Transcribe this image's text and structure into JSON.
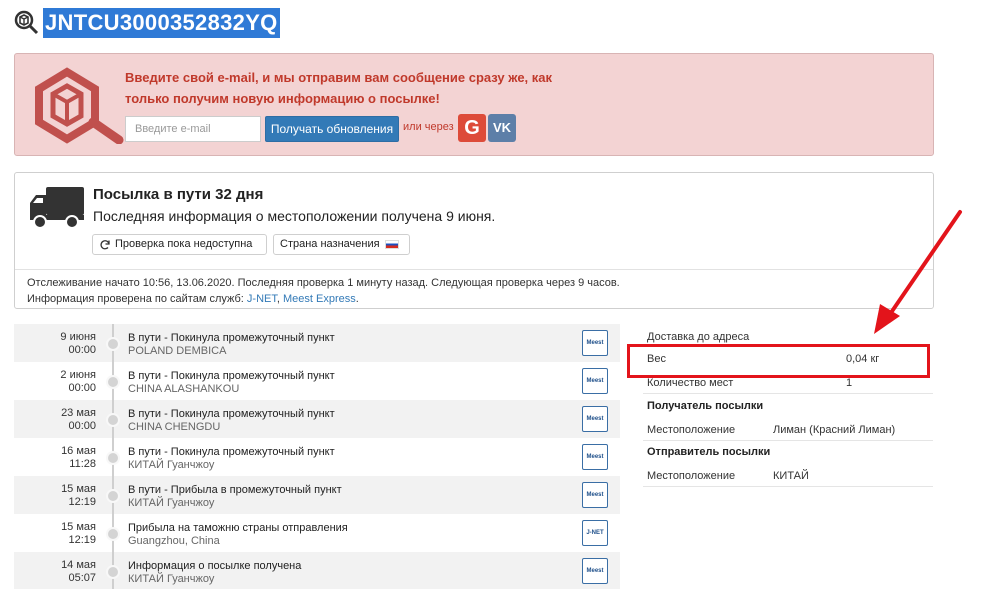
{
  "header": {
    "track_number": "JNTCU3000352832YQ",
    "icon": "package-search-icon"
  },
  "promo": {
    "message": "Введите свой e-mail, и мы отправим вам сообщение сразу же, как только получим новую информацию о посылке!",
    "email_placeholder": "Введите e-mail",
    "subscribe_label": "Получать обновления",
    "or_via_label": "или через",
    "google_label": "G",
    "vk_label": "VK",
    "accent_color": "#c0392b"
  },
  "status": {
    "title": "Посылка в пути 32 дня",
    "subtitle": "Последняя информация о местоположении получена 9 июня.",
    "check_chip": "Проверка пока недоступна",
    "destination_chip": "Страна назначения",
    "footer_line1": "Отслеживание начато 10:56, 13.06.2020. Последняя проверка 1 минуту назад. Следующая проверка через 9 часов.",
    "footer_line2_prefix": "Информация проверена по сайтам служб: ",
    "service_1": "J-NET",
    "separator": ", ",
    "service_2": "Meest Express",
    "footer_line2_suffix": "."
  },
  "timeline": [
    {
      "date": "9 июня",
      "time": "00:00",
      "event": "В пути - Покинула промежуточный пункт",
      "location": "POLAND DEMBICA",
      "logo": "Meest"
    },
    {
      "date": "2 июня",
      "time": "00:00",
      "event": "В пути - Покинула промежуточный пункт",
      "location": "CHINA ALASHANKOU",
      "logo": "Meest"
    },
    {
      "date": "23 мая",
      "time": "00:00",
      "event": "В пути - Покинула промежуточный пункт",
      "location": "CHINA CHENGDU",
      "logo": "Meest"
    },
    {
      "date": "16 мая",
      "time": "11:28",
      "event": "В пути - Покинула промежуточный пункт",
      "location": "КИТАЙ Гуанчжоу",
      "logo": "Meest"
    },
    {
      "date": "15 мая",
      "time": "12:19",
      "event": "В пути - Прибыла в промежуточный пункт",
      "location": "КИТАЙ Гуанчжоу",
      "logo": "Meest"
    },
    {
      "date": "15 мая",
      "time": "12:19",
      "event": "Прибыла на таможню страны отправления",
      "location": "Guangzhou, China",
      "logo": "J-NET"
    },
    {
      "date": "14 мая",
      "time": "05:07",
      "event": "Информация о посылке получена",
      "location": "КИТАЙ Гуанчжоу",
      "logo": "Meest"
    }
  ],
  "info": {
    "delivery_label": "Доставка до адреса",
    "weight_label": "Вес",
    "weight_value": "0,04 кг",
    "pieces_label": "Количество мест",
    "pieces_value": "1",
    "recipient_header": "Получатель посылки",
    "recipient_location_label": "Местоположение",
    "recipient_location_value": "Лиман (Красний Лиман)",
    "sender_header": "Отправитель посылки",
    "sender_location_label": "Местоположение",
    "sender_location_value": "КИТАЙ"
  },
  "annotation": {
    "color": "#e3141b"
  }
}
